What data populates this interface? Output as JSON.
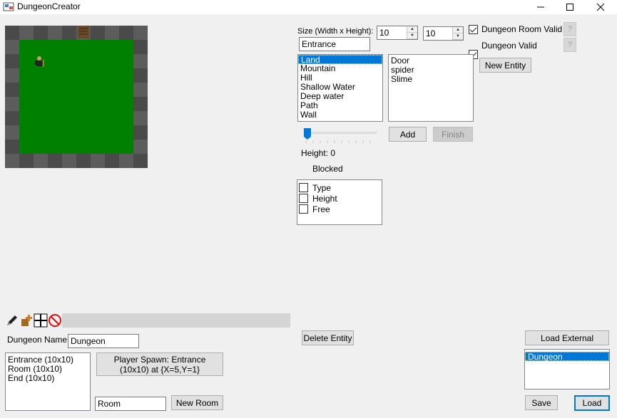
{
  "window": {
    "title": "DungeonCreator"
  },
  "map": {
    "grid_cols": 10,
    "grid_rows": 10,
    "spawn_label": ""
  },
  "size": {
    "label": "Size (Width x Height):",
    "width": "10",
    "height": "10"
  },
  "room_name_field": "Entrance",
  "checks": {
    "room_valid_label": "Dungeon Room Valid",
    "dungeon_valid_label": "Dungeon Valid",
    "help": "?"
  },
  "terrain_list": [
    "Land",
    "Mountain",
    "Hill",
    "Shallow Water",
    "Deep water",
    "Path",
    "Wall"
  ],
  "entity_list": [
    "Door",
    "spider",
    "Slime"
  ],
  "buttons": {
    "new_entity": "New Entity",
    "add": "Add",
    "finish": "Finish",
    "delete_entity": "Delete Entity",
    "load_external": "Load External",
    "save": "Save",
    "load": "Load",
    "new_room": "New Room",
    "player_spawn": "Player Spawn: Entrance (10x10) at {X=5,Y=1}"
  },
  "height_slider": {
    "label": "Height: 0",
    "value": 0
  },
  "blocked_label": "Blocked",
  "filters": [
    "Type",
    "Height",
    "Free"
  ],
  "dungeon_name": {
    "label": "Dungeon Name",
    "value": "Dungeon"
  },
  "rooms": [
    "Entrance (10x10)",
    "Room (10x10)",
    "End (10x10)"
  ],
  "new_room_field": "Room",
  "dungeons": [
    "Dungeon"
  ]
}
